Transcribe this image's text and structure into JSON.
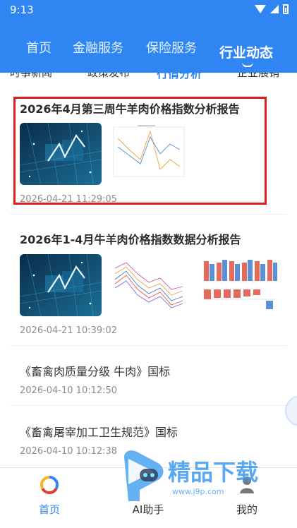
{
  "status": {
    "time": "9:13"
  },
  "main_tabs": [
    {
      "label": "首页"
    },
    {
      "label": "金融服务"
    },
    {
      "label": "保险服务"
    },
    {
      "label": "行业动态"
    }
  ],
  "sub_tabs": [
    {
      "label": "时事新闻"
    },
    {
      "label": "政策发布"
    },
    {
      "label": "行情分析"
    },
    {
      "label": "企业展销"
    }
  ],
  "articles": [
    {
      "title": "2026年4月第三周牛羊肉价格指数分析报告",
      "date": "2026-04-21 11:29:05"
    },
    {
      "title": "2026年1-4月牛羊肉价格指数数据分析报告",
      "date": "2026-04-21 10:39:02"
    },
    {
      "title": "《畜禽肉质量分级 牛肉》国标",
      "date": "2026-04-10 10:12:50"
    },
    {
      "title": "《畜禽屠宰加工卫生规范》国标",
      "date": "2026-04-10 10:12:38"
    }
  ],
  "bottom_nav": [
    {
      "label": "首页",
      "icon": "home-logo-icon"
    },
    {
      "label": "AI助手",
      "icon": "ai-assistant-icon"
    },
    {
      "label": "我的",
      "icon": "profile-icon"
    }
  ],
  "watermark": {
    "text": "精品下载",
    "url": "www.j9p.com"
  },
  "colors": {
    "brand_blue": "#2f86f2",
    "highlight_red": "#e01b1b"
  }
}
